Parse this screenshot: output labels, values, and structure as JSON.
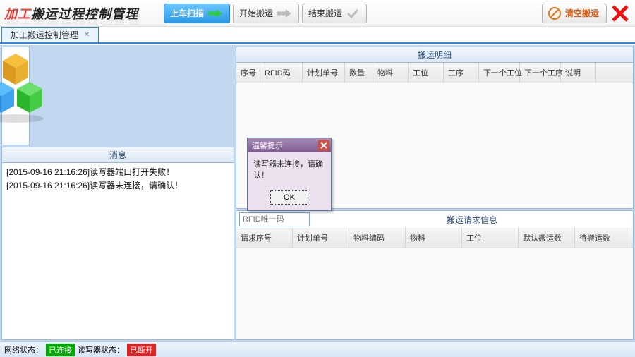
{
  "title": {
    "red": "加工",
    "black": "搬运过程控制管理",
    "shadow": "加工搬运过程控制管理"
  },
  "toolbar": {
    "scan": "上车扫描",
    "start": "开始搬运",
    "end": "结束搬运",
    "clear": "清空搬运"
  },
  "tab": {
    "label": "加工搬运控制管理"
  },
  "panels": {
    "msg_title": "消息",
    "detail_title": "搬运明细",
    "req_title": "搬运请求信息",
    "rfid_placeholder": "RFID唯一码"
  },
  "messages": [
    "[2015-09-16 21:16:26]读写器端口打开失败！",
    "[2015-09-16 21:16:26]读写器未连接，请确认！"
  ],
  "detail_cols": [
    "序号",
    "RFID码",
    "计划单号",
    "数量",
    "物料",
    "工位",
    "工序",
    "下一个工位",
    "下一个工序",
    "说明"
  ],
  "req_cols": [
    "请求序号",
    "计划单号",
    "物料编码",
    "物料",
    "工位",
    "默认搬运数",
    "待搬运数"
  ],
  "dialog": {
    "title": "温馨提示",
    "body": "读写器未连接，请确认！",
    "ok": "OK"
  },
  "status": {
    "net_label": "网络状态：",
    "net_value": "已连接",
    "reader_label": "读写器状态：",
    "reader_value": "已断开"
  },
  "colors": {
    "accent": "#2a8be0",
    "ok": "#00aa00",
    "err": "#dd2222",
    "clear": "#e07a1a"
  }
}
